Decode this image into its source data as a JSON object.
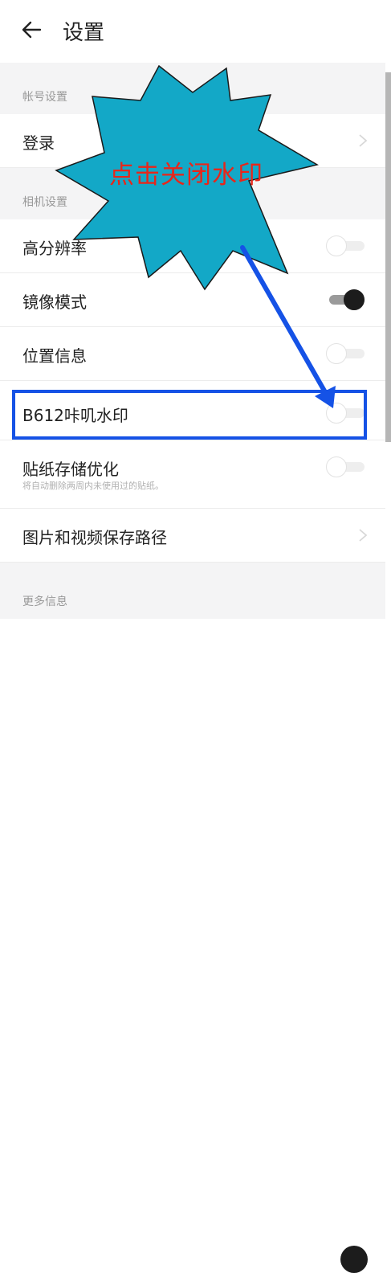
{
  "header": {
    "title": "设置",
    "back_icon": "arrow-left-icon"
  },
  "sections": {
    "account": "帐号设置",
    "camera": "相机设置",
    "more": "更多信息"
  },
  "rows": {
    "login": {
      "label": "登录",
      "type": "link"
    },
    "hd": {
      "label": "高分辨率",
      "type": "toggle",
      "on": false
    },
    "mirror": {
      "label": "镜像模式",
      "type": "toggle",
      "on": true
    },
    "location": {
      "label": "位置信息",
      "type": "toggle",
      "on": false
    },
    "watermark": {
      "label": "B612咔叽水印",
      "type": "toggle",
      "on": false
    },
    "sticker": {
      "label": "贴纸存储优化",
      "sub": "将自动删除两周内未使用过的贴纸。",
      "type": "toggle",
      "on": false
    },
    "save_path": {
      "label": "图片和视频保存路径",
      "type": "link"
    }
  },
  "annotation": {
    "text": "点击关闭水印",
    "burst_color": "#13a8c7",
    "text_color": "#e8261a",
    "arrow_color": "#1552e6"
  }
}
